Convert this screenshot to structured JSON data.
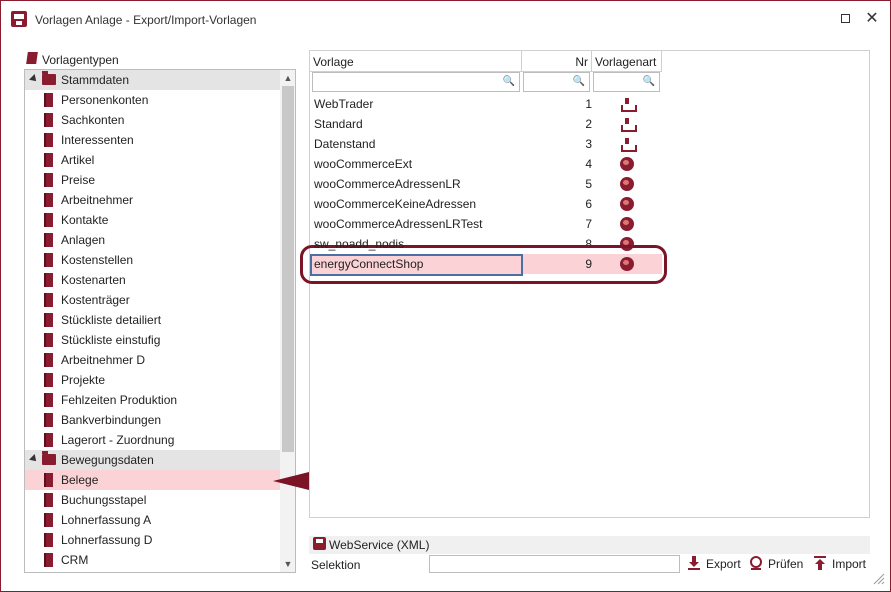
{
  "window": {
    "title": "Vorlagen Anlage - Export/Import-Vorlagen",
    "accent": "#8a1c2f",
    "selection_color": "#fbd3d6"
  },
  "left": {
    "header": "Vorlagentypen",
    "groups": [
      {
        "label": "Stammdaten",
        "items": [
          "Personenkonten",
          "Sachkonten",
          "Interessenten",
          "Artikel",
          "Preise",
          "Arbeitnehmer",
          "Kontakte",
          "Anlagen",
          "Kostenstellen",
          "Kostenarten",
          "Kostenträger",
          "Stückliste detailiert",
          "Stückliste einstufig",
          "Arbeitnehmer D",
          "Projekte",
          "Fehlzeiten Produktion",
          "Bankverbindungen",
          "Lagerort - Zuordnung"
        ]
      },
      {
        "label": "Bewegungsdaten",
        "items": [
          "Belege",
          "Buchungsstapel",
          "Lohnerfassung A",
          "Lohnerfassung D",
          "CRM"
        ]
      }
    ],
    "selected_item": "Belege"
  },
  "grid": {
    "columns": [
      "Vorlage",
      "Nr",
      "Vorlagenart"
    ],
    "rows": [
      {
        "name": "WebTrader",
        "nr": "1",
        "art": "tray-icon"
      },
      {
        "name": "Standard",
        "nr": "2",
        "art": "tray-icon"
      },
      {
        "name": "Datenstand",
        "nr": "3",
        "art": "tray-icon"
      },
      {
        "name": "wooCommerceExt",
        "nr": "4",
        "art": "globe-icon"
      },
      {
        "name": "wooCommerceAdressenLR",
        "nr": "5",
        "art": "globe-icon"
      },
      {
        "name": "wooCommerceKeineAdressen",
        "nr": "6",
        "art": "globe-icon"
      },
      {
        "name": "wooCommerceAdressenLRTest",
        "nr": "7",
        "art": "globe-icon"
      },
      {
        "name": "sw_noadd_nodis",
        "nr": "8",
        "art": "globe-icon"
      },
      {
        "name": "energyConnectShop",
        "nr": "9",
        "art": "globe-icon"
      }
    ],
    "selected_row": "energyConnectShop"
  },
  "bottom": {
    "webservice_label": "WebService (XML)",
    "selektion_label": "Selektion",
    "selektion_value": "",
    "actions": {
      "export": "Export",
      "pruefen": "Prüfen",
      "import": "Import"
    }
  }
}
